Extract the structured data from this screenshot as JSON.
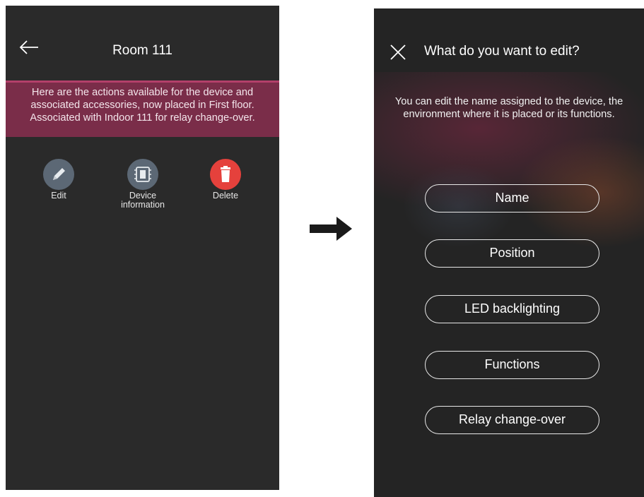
{
  "left_screen": {
    "title": "Room 111",
    "info_text": "Here are the actions available for the device and associated accessories, now placed in First floor. Associated with Indoor 111 for relay change-over.",
    "actions": [
      {
        "label": "Edit",
        "icon": "pencil-icon",
        "color": "#5c6875"
      },
      {
        "label": "Device information",
        "icon": "device-chip-icon",
        "color": "#5c6875"
      },
      {
        "label": "Delete",
        "icon": "trash-icon",
        "color": "#e5413c"
      }
    ],
    "banner_color": "#7a2d49"
  },
  "right_screen": {
    "title": "What do you want to edit?",
    "description": "You can edit the name assigned to the device, the environment where it is placed or its functions.",
    "options": [
      "Name",
      "Position",
      "LED backlighting",
      "Functions",
      "Relay change-over"
    ]
  }
}
